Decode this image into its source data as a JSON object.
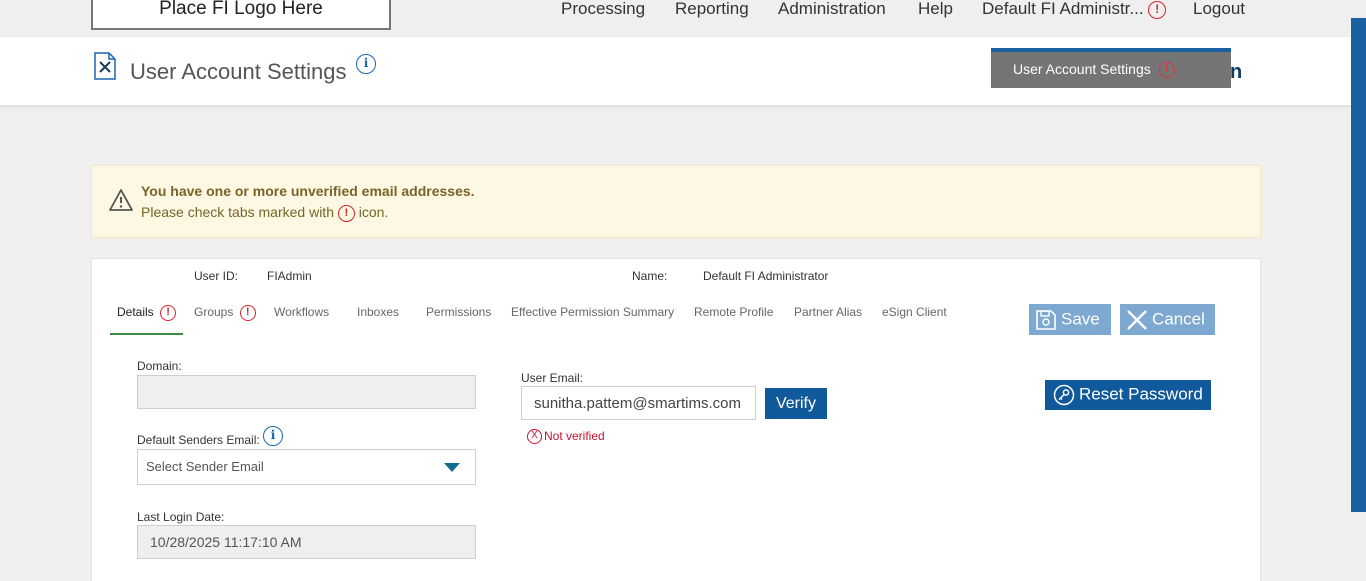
{
  "topnav": {
    "logo_text": "Place FI Logo Here",
    "items": [
      "Processing",
      "Reporting",
      "Administration",
      "Help",
      "Default FI Administr...",
      "Logout"
    ],
    "alert_mark": "!"
  },
  "header": {
    "title": "User Account Settings",
    "info_mark": "i",
    "tooltip": "User Account Settings",
    "trailing_char": "n"
  },
  "banner": {
    "heading": "You have one or more unverified email addresses.",
    "text_before": "Please check tabs marked with",
    "text_after": "icon."
  },
  "user": {
    "id_label": "User ID:",
    "id_value": "FIAdmin",
    "name_label": "Name:",
    "name_value": "Default FI Administrator"
  },
  "tabs": [
    "Details",
    "Groups",
    "Workflows",
    "Inboxes",
    "Permissions",
    "Effective Permission Summary",
    "Remote Profile",
    "Partner Alias",
    "eSign Client"
  ],
  "actions": {
    "save": "Save",
    "cancel": "Cancel",
    "reset_password": "Reset Password",
    "verify": "Verify"
  },
  "form": {
    "domain_label": "Domain:",
    "domain_value": "",
    "senders_label": "Default Senders Email:",
    "senders_value": "Select Sender Email",
    "last_login_label": "Last Login Date:",
    "last_login_value": "10/28/2025 11:17:10 AM",
    "user_email_label": "User Email:",
    "user_email_value": "sunitha.pattem@smartims.com",
    "email_status": "Not verified",
    "email_status_mark": "X"
  },
  "colors": {
    "primary": "#10599a",
    "disabled_button": "#7da8cf",
    "alert": "#d9232d",
    "banner_bg": "#fcf8e3",
    "active_tab": "#3b8a3e"
  },
  "icons": [
    "document-tools-icon",
    "info-icon",
    "alert-circle-icon",
    "warning-triangle-icon",
    "save-disk-icon",
    "close-x-icon",
    "key-icon",
    "chevron-down-icon"
  ]
}
